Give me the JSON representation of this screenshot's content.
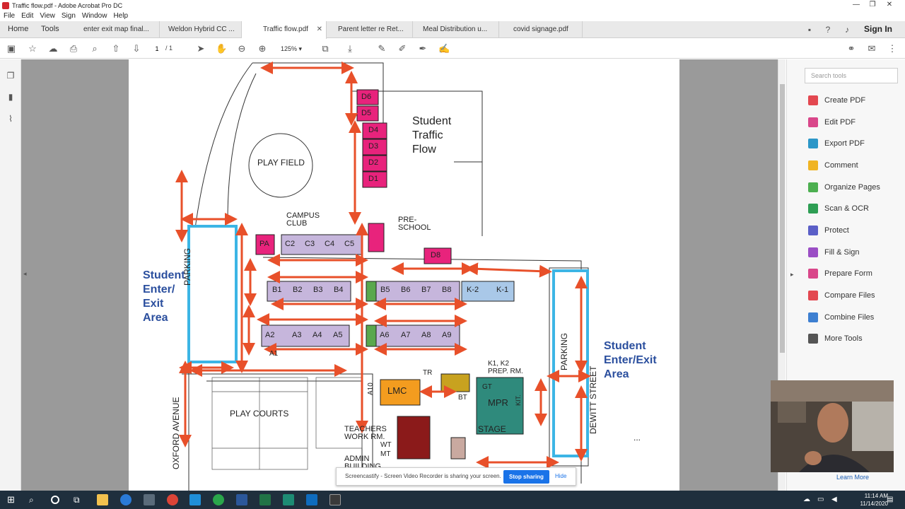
{
  "window": {
    "title": "Traffic flow.pdf - Adobe Acrobat Pro DC"
  },
  "menu": [
    "File",
    "Edit",
    "View",
    "Sign",
    "Window",
    "Help"
  ],
  "nav": {
    "home": "Home",
    "tools": "Tools",
    "sign_in": "Sign In"
  },
  "tabs": [
    {
      "label": "enter exit map final..."
    },
    {
      "label": "Weldon Hybrid CC ..."
    },
    {
      "label": "Traffic flow.pdf"
    },
    {
      "label": "Parent letter re Ret..."
    },
    {
      "label": "Meal Distribution u..."
    },
    {
      "label": "covid signage.pdf"
    }
  ],
  "toolbar": {
    "page_current": "1",
    "page_total": "/ 1",
    "zoom": "125%"
  },
  "right_panel": {
    "search_placeholder": "Search tools",
    "tools": [
      {
        "label": "Create PDF",
        "icon": "create-pdf-icon",
        "color": "#e34850"
      },
      {
        "label": "Edit PDF",
        "icon": "edit-pdf-icon",
        "color": "#d9478a"
      },
      {
        "label": "Export PDF",
        "icon": "export-pdf-icon",
        "color": "#2c97c8"
      },
      {
        "label": "Comment",
        "icon": "comment-icon",
        "color": "#f0b423"
      },
      {
        "label": "Organize Pages",
        "icon": "organize-pages-icon",
        "color": "#4caf50"
      },
      {
        "label": "Scan & OCR",
        "icon": "scan-ocr-icon",
        "color": "#2e9e54"
      },
      {
        "label": "Protect",
        "icon": "protect-icon",
        "color": "#5b5fc7"
      },
      {
        "label": "Fill & Sign",
        "icon": "fill-sign-icon",
        "color": "#9b4ec5"
      },
      {
        "label": "Prepare Form",
        "icon": "prepare-form-icon",
        "color": "#d9478a"
      },
      {
        "label": "Compare Files",
        "icon": "compare-files-icon",
        "color": "#e34850"
      },
      {
        "label": "Combine Files",
        "icon": "combine-files-icon",
        "color": "#3d7fd1"
      },
      {
        "label": "More Tools",
        "icon": "more-tools-icon",
        "color": "#555555"
      }
    ]
  },
  "map": {
    "play_field": "PLAY FIELD",
    "campus_club": "CAMPUS CLUB",
    "preschool": "PRE- SCHOOL",
    "student_traffic_flow": [
      "Student",
      "Traffic",
      "Flow"
    ],
    "student_enter_exit_left": [
      "Student",
      "Enter/",
      "Exit",
      "Area"
    ],
    "student_enter_exit_right": [
      "Student",
      "Enter/Exit",
      "Area"
    ],
    "parking": "PARKING",
    "play_courts": "PLAY COURTS",
    "oxford_avenue": "OXFORD AVENUE",
    "dewitt_street": "DEWITT STREET",
    "lmc": "LMC",
    "mpr": "MPR",
    "stage": "STAGE",
    "teachers_work_rm": [
      "TEACHERS",
      "WORK RM."
    ],
    "admin_building": [
      "ADMIN",
      "BUILDING"
    ],
    "prep_rm": [
      "K1, K2",
      "PREP. RM."
    ],
    "rooms_d": [
      "D6",
      "D5",
      "D4",
      "D3",
      "D2",
      "D1"
    ],
    "d8": "D8",
    "pa": "PA",
    "rooms_c": [
      "C2",
      "C3",
      "C4",
      "C5"
    ],
    "rooms_b": [
      "B1",
      "B2",
      "B3",
      "B4",
      "B5",
      "B6",
      "B7",
      "B8"
    ],
    "rooms_k": [
      "K-2",
      "K-1"
    ],
    "rooms_a": [
      "A2",
      "A3",
      "A4",
      "A5",
      "A6",
      "A7",
      "A8",
      "A9"
    ],
    "a1": "A1",
    "a10": "A10",
    "labels_small": {
      "tr": "TR",
      "gt": "GT",
      "bt": "BT",
      "wt": "WT",
      "mt": "MT",
      "kit": "KIT."
    },
    "ellipsis": "..."
  },
  "colors": {
    "room_d": "#e8237c",
    "room_purple": "#c6b6dc",
    "room_blue": "#a9c8e8",
    "arrow": "#e8502a",
    "enter_exit_box": "#3cb5e5",
    "enter_exit_text": "#2b4f9e",
    "lmc": "#f39c1f",
    "mpr": "#2f8a7c",
    "admin": "#8b1a1a"
  },
  "screencastify": {
    "message": "Screencastify - Screen Video Recorder is sharing your screen.",
    "stop": "Stop sharing",
    "hide": "Hide"
  },
  "webcam": {
    "learn_more": "Learn More"
  },
  "clock": {
    "time": "11:14 AM",
    "date": "11/14/2020"
  }
}
